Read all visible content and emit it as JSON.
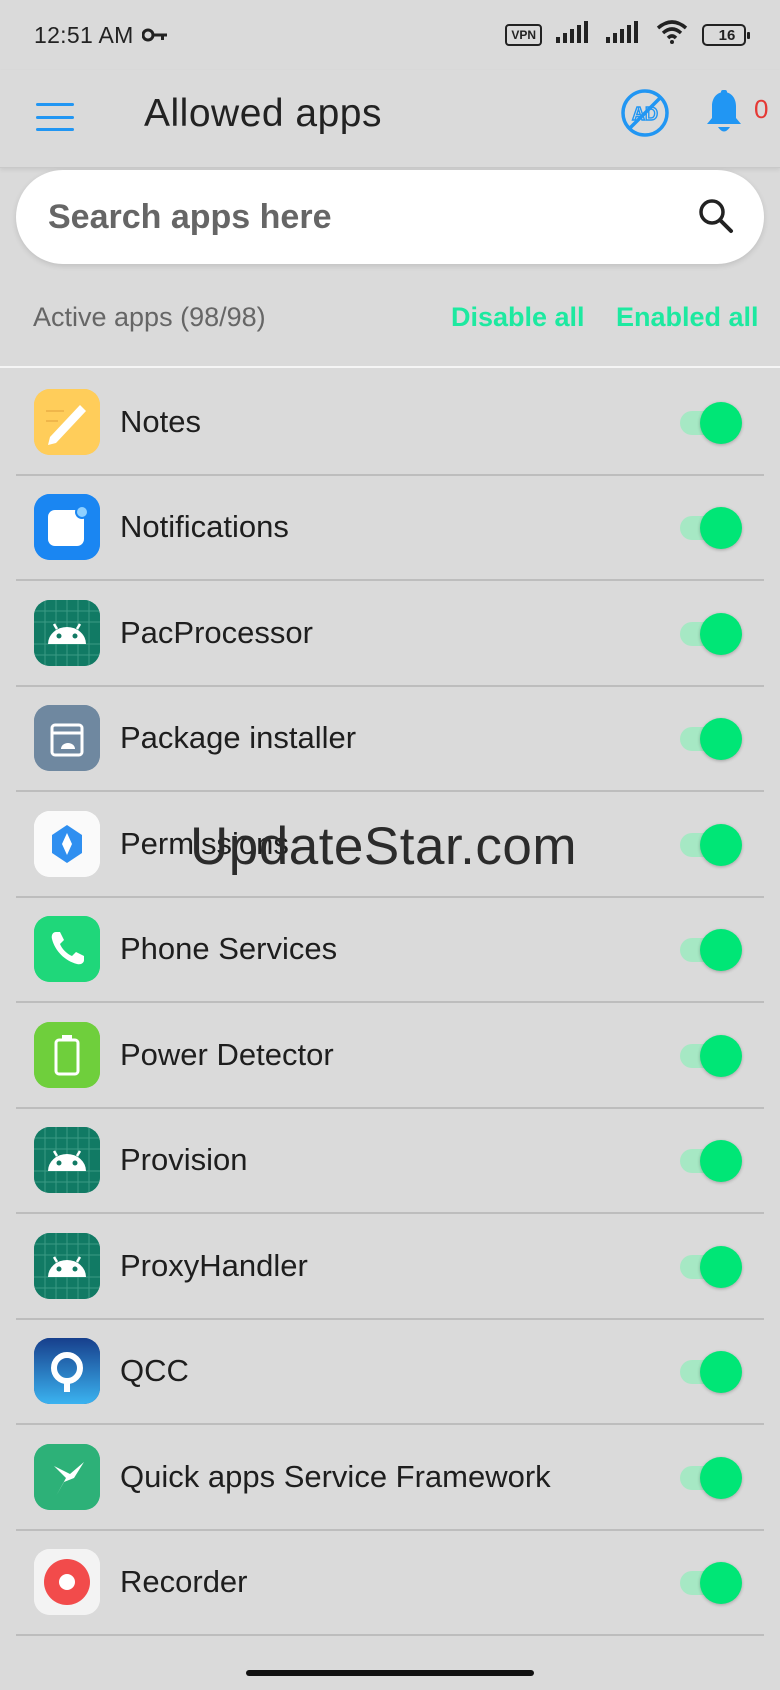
{
  "status_bar": {
    "time": "12:51 AM",
    "vpn": "VPN",
    "battery": "16"
  },
  "app_bar": {
    "title": "Allowed apps",
    "notification_count": "0"
  },
  "search": {
    "placeholder": "Search apps here"
  },
  "filters": {
    "active_label": "Active apps (98/98)",
    "disable_all": "Disable all",
    "enable_all": "Enabled all"
  },
  "colors": {
    "accent_blue": "#2196f3",
    "toggle_on": "#00e676",
    "action_green": "#1de9a0"
  },
  "apps": [
    {
      "name": "Notes",
      "icon": "notes-icon",
      "enabled": true
    },
    {
      "name": "Notifications",
      "icon": "notifications-icon",
      "enabled": true
    },
    {
      "name": "PacProcessor",
      "icon": "android-icon",
      "enabled": true
    },
    {
      "name": "Package installer",
      "icon": "package-installer-icon",
      "enabled": true
    },
    {
      "name": "Permissions",
      "icon": "permissions-icon",
      "enabled": true
    },
    {
      "name": "Phone Services",
      "icon": "phone-icon",
      "enabled": true
    },
    {
      "name": "Power Detector",
      "icon": "battery-icon",
      "enabled": true
    },
    {
      "name": "Provision",
      "icon": "android-icon",
      "enabled": true
    },
    {
      "name": "ProxyHandler",
      "icon": "android-icon",
      "enabled": true
    },
    {
      "name": "QCC",
      "icon": "qcc-icon",
      "enabled": true
    },
    {
      "name": "Quick apps Service Framework",
      "icon": "hummingbird-icon",
      "enabled": true
    },
    {
      "name": "Recorder",
      "icon": "recorder-icon",
      "enabled": true
    }
  ],
  "watermark": "UpdateStar.com"
}
